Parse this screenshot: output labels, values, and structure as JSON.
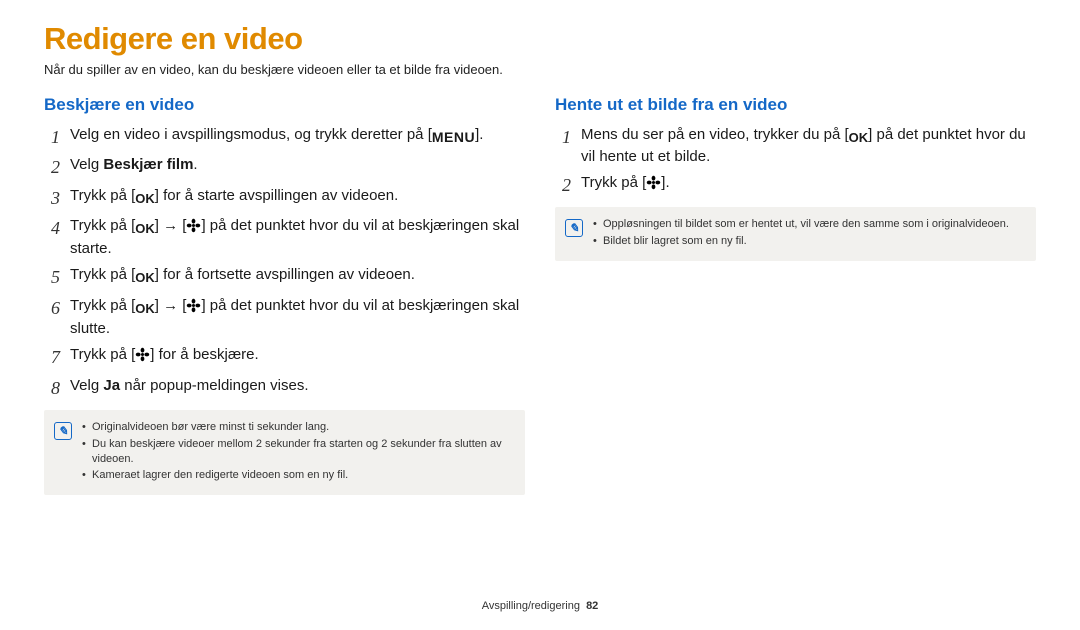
{
  "title": "Redigere en video",
  "intro": "Når du spiller av en video, kan du beskjære videoen eller ta et bilde fra videoen.",
  "left": {
    "heading": "Beskjære en video",
    "steps": [
      {
        "n": "1",
        "pre": "Velg en video i avspillingsmodus, og trykk deretter på [",
        "icon": "menu",
        "post": "]."
      },
      {
        "n": "2",
        "pre": "Velg ",
        "bold": "Beskjær film",
        "post": "."
      },
      {
        "n": "3",
        "pre": "Trykk på [",
        "icon": "ok",
        "post": "] for å starte avspillingen av videoen."
      },
      {
        "n": "4",
        "pre": "Trykk på [",
        "icon": "ok",
        "mid1": "] → [",
        "icon2": "flower",
        "post": "] på det punktet hvor du vil at beskjæringen skal starte."
      },
      {
        "n": "5",
        "pre": "Trykk på [",
        "icon": "ok",
        "post": "] for å fortsette avspillingen av videoen."
      },
      {
        "n": "6",
        "pre": "Trykk på [",
        "icon": "ok",
        "mid1": "] → [",
        "icon2": "flower",
        "post": "] på det punktet hvor du vil at beskjæringen skal slutte."
      },
      {
        "n": "7",
        "pre": "Trykk på [",
        "icon": "flower",
        "post": "] for å beskjære."
      },
      {
        "n": "8",
        "pre": "Velg ",
        "bold": "Ja",
        "post": " når popup-meldingen vises."
      }
    ],
    "notes": [
      "Originalvideoen bør være minst ti sekunder lang.",
      "Du kan beskjære videoer mellom 2 sekunder fra starten og 2 sekunder fra slutten av videoen.",
      "Kameraet lagrer den redigerte videoen som en ny fil."
    ]
  },
  "right": {
    "heading": "Hente ut et bilde fra en video",
    "steps": [
      {
        "n": "1",
        "pre": "Mens du ser på en video, trykker du på [",
        "icon": "ok",
        "post": "] på det punktet hvor du vil hente ut et bilde."
      },
      {
        "n": "2",
        "pre": "Trykk på [",
        "icon": "flower",
        "post": "]."
      }
    ],
    "notes": [
      "Oppløsningen til bildet som er hentet ut, vil være den samme som i originalvideoen.",
      "Bildet blir lagret som en ny fil."
    ]
  },
  "footer_section": "Avspilling/redigering",
  "footer_page": "82",
  "noteGlyph": "✎"
}
